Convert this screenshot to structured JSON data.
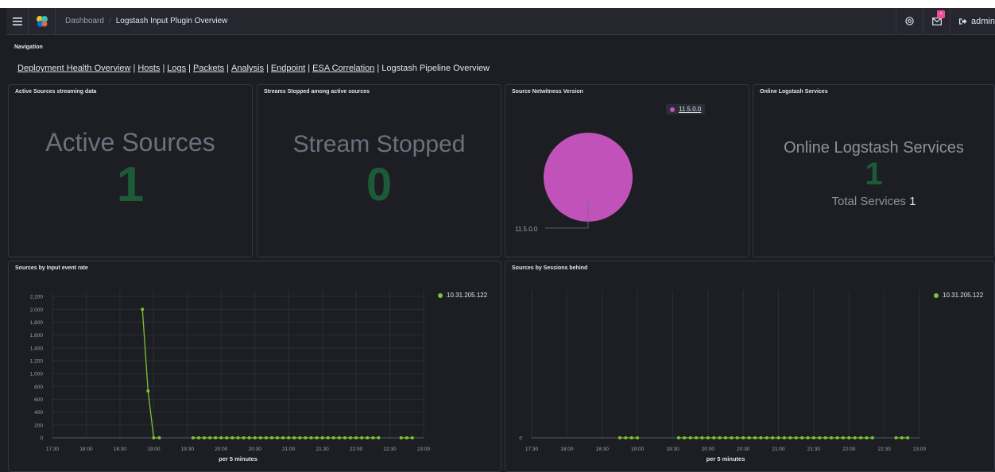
{
  "header": {
    "breadcrumb_parent": "Dashboard",
    "breadcrumb_current": "Logstash Input Plugin Overview",
    "user": "admin",
    "mail_badge": "•"
  },
  "navigation": {
    "title": "Navigation",
    "links": [
      "Deployment Health Overview",
      "Hosts",
      "Logs",
      "Packets",
      "Analysis",
      "Endpoint",
      "ESA Correlation"
    ],
    "current": "Logstash Pipeline Overview"
  },
  "panels": {
    "active_sources": {
      "title": "Active Sources streaming data",
      "label": "Active Sources",
      "value": "1"
    },
    "streams_stopped": {
      "title": "Streams Stopped among active sources",
      "label": "Stream Stopped",
      "value": "0"
    },
    "netwitness_version": {
      "title": "Source Netwitness Version",
      "legend": "11.5.0.0",
      "slice_label": "11.5.0.0"
    },
    "online_logstash": {
      "title": "Online Logstash Services",
      "label": "Online Logstash Services",
      "value": "1",
      "total_label": "Total Services",
      "total_value": "1"
    },
    "input_event_rate": {
      "title": "Sources by Input event rate",
      "xlabel": "per 5 minutes",
      "legend": "10.31.205.122"
    },
    "sessions_behind": {
      "title": "Sources by Sessions behind",
      "xlabel": "per 5 minutes",
      "legend": "10.31.205.122"
    }
  },
  "colors": {
    "series": "#7bc42d",
    "pie": "#c152ba",
    "metric": "#1d5a37",
    "badge": "#f04e98"
  },
  "chart_data": [
    {
      "type": "pie",
      "title": "Source Netwitness Version",
      "slices": [
        {
          "label": "11.5.0.0",
          "value": 100
        }
      ]
    },
    {
      "type": "line",
      "title": "Sources by Input event rate",
      "xlabel": "per 5 minutes",
      "x_ticks": [
        "17:30",
        "18:00",
        "18:30",
        "19:00",
        "19:30",
        "20:00",
        "20:30",
        "21:00",
        "21:30",
        "22:00",
        "22:30",
        "23:00"
      ],
      "y_ticks": [
        0,
        200,
        400,
        600,
        800,
        1000,
        1200,
        1400,
        1600,
        1800,
        2000,
        2200
      ],
      "ylim": [
        0,
        2300
      ],
      "series": [
        {
          "name": "10.31.205.122",
          "segments": [
            {
              "points": [
                [
                  "18:50",
                  2000
                ],
                [
                  "18:55",
                  730
                ],
                [
                  "19:00",
                  0
                ],
                [
                  "19:05",
                  0
                ]
              ]
            },
            {
              "points": [
                [
                  "19:35",
                  0
                ],
                [
                  "19:40",
                  0
                ],
                [
                  "19:45",
                  0
                ],
                [
                  "19:50",
                  0
                ],
                [
                  "19:55",
                  0
                ],
                [
                  "20:00",
                  0
                ],
                [
                  "20:05",
                  0
                ],
                [
                  "20:10",
                  0
                ],
                [
                  "20:15",
                  0
                ],
                [
                  "20:20",
                  0
                ],
                [
                  "20:25",
                  0
                ],
                [
                  "20:30",
                  0
                ],
                [
                  "20:35",
                  0
                ],
                [
                  "20:40",
                  0
                ],
                [
                  "20:45",
                  0
                ],
                [
                  "20:50",
                  0
                ],
                [
                  "20:55",
                  0
                ],
                [
                  "21:00",
                  0
                ],
                [
                  "21:05",
                  0
                ],
                [
                  "21:10",
                  0
                ],
                [
                  "21:15",
                  0
                ],
                [
                  "21:20",
                  0
                ],
                [
                  "21:25",
                  0
                ],
                [
                  "21:30",
                  0
                ],
                [
                  "21:35",
                  0
                ],
                [
                  "21:40",
                  0
                ],
                [
                  "21:45",
                  0
                ],
                [
                  "21:50",
                  0
                ],
                [
                  "21:55",
                  0
                ],
                [
                  "22:00",
                  0
                ],
                [
                  "22:05",
                  0
                ],
                [
                  "22:10",
                  0
                ],
                [
                  "22:15",
                  0
                ],
                [
                  "22:20",
                  0
                ]
              ]
            },
            {
              "points": [
                [
                  "22:40",
                  0
                ],
                [
                  "22:45",
                  0
                ],
                [
                  "22:50",
                  0
                ]
              ]
            }
          ]
        }
      ]
    },
    {
      "type": "line",
      "title": "Sources by Sessions behind",
      "xlabel": "per 5 minutes",
      "x_ticks": [
        "17:30",
        "18:00",
        "18:30",
        "19:00",
        "19:30",
        "20:00",
        "20:30",
        "21:00",
        "21:30",
        "22:00",
        "22:30",
        "23:00"
      ],
      "y_ticks": [
        0
      ],
      "ylim": [
        0,
        1
      ],
      "series": [
        {
          "name": "10.31.205.122",
          "segments": [
            {
              "points": [
                [
                  "18:45",
                  0
                ],
                [
                  "18:50",
                  0
                ],
                [
                  "18:55",
                  0
                ],
                [
                  "19:00",
                  0
                ]
              ]
            },
            {
              "points": [
                [
                  "19:35",
                  0
                ],
                [
                  "19:40",
                  0
                ],
                [
                  "19:45",
                  0
                ],
                [
                  "19:50",
                  0
                ],
                [
                  "19:55",
                  0
                ],
                [
                  "20:00",
                  0
                ],
                [
                  "20:05",
                  0
                ],
                [
                  "20:10",
                  0
                ],
                [
                  "20:15",
                  0
                ],
                [
                  "20:20",
                  0
                ],
                [
                  "20:25",
                  0
                ],
                [
                  "20:30",
                  0
                ],
                [
                  "20:35",
                  0
                ],
                [
                  "20:40",
                  0
                ],
                [
                  "20:45",
                  0
                ],
                [
                  "20:50",
                  0
                ],
                [
                  "20:55",
                  0
                ],
                [
                  "21:00",
                  0
                ],
                [
                  "21:05",
                  0
                ],
                [
                  "21:10",
                  0
                ],
                [
                  "21:15",
                  0
                ],
                [
                  "21:20",
                  0
                ],
                [
                  "21:25",
                  0
                ],
                [
                  "21:30",
                  0
                ],
                [
                  "21:35",
                  0
                ],
                [
                  "21:40",
                  0
                ],
                [
                  "21:45",
                  0
                ],
                [
                  "21:50",
                  0
                ],
                [
                  "21:55",
                  0
                ],
                [
                  "22:00",
                  0
                ],
                [
                  "22:05",
                  0
                ],
                [
                  "22:10",
                  0
                ],
                [
                  "22:15",
                  0
                ],
                [
                  "22:20",
                  0
                ]
              ]
            },
            {
              "points": [
                [
                  "22:40",
                  0
                ],
                [
                  "22:45",
                  0
                ],
                [
                  "22:50",
                  0
                ]
              ]
            }
          ]
        }
      ]
    }
  ]
}
